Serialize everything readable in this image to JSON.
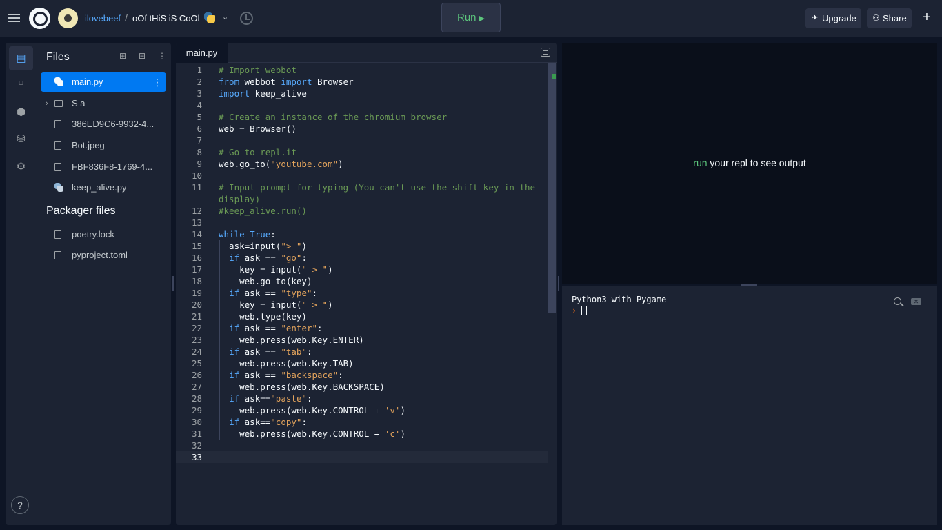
{
  "topbar": {
    "username": "ilovebeef",
    "separator": "/",
    "repl_name": "oOf tHiS iS CoOl",
    "run_label": "Run",
    "run_icon": "▶",
    "upgrade_label": "Upgrade",
    "share_label": "Share",
    "plus_label": "+"
  },
  "sidebar": {
    "files_title": "Files",
    "packager_title": "Packager files",
    "files": [
      {
        "name": "main.py",
        "icon": "python-icon",
        "selected": true
      },
      {
        "name": "S a",
        "icon": "folder-icon"
      },
      {
        "name": "386ED9C6-9932-4...",
        "icon": "file-icon"
      },
      {
        "name": "Bot.jpeg",
        "icon": "file-icon"
      },
      {
        "name": "FBF836F8-1769-4...",
        "icon": "file-icon"
      },
      {
        "name": "keep_alive.py",
        "icon": "python-icon"
      }
    ],
    "packager_files": [
      {
        "name": "poetry.lock"
      },
      {
        "name": "pyproject.toml"
      }
    ],
    "help_label": "?"
  },
  "editor": {
    "tab_label": "main.py",
    "lines": [
      {
        "n": "1",
        "code": "# Import webbot"
      },
      {
        "n": "2",
        "code": "from webbot import Browser"
      },
      {
        "n": "3",
        "code": "import keep_alive"
      },
      {
        "n": "4",
        "code": ""
      },
      {
        "n": "5",
        "code": "# Create an instance of the chromium browser"
      },
      {
        "n": "6",
        "code": "web = Browser()"
      },
      {
        "n": "7",
        "code": ""
      },
      {
        "n": "8",
        "code": "# Go to repl.it"
      },
      {
        "n": "9",
        "code": "web.go_to(\"youtube.com\")"
      },
      {
        "n": "10",
        "code": ""
      },
      {
        "n": "11",
        "code": "# Input prompt for typing (You can't use the shift key in the"
      },
      {
        "n": "",
        "code": "display)"
      },
      {
        "n": "12",
        "code": "#keep_alive.run()"
      },
      {
        "n": "13",
        "code": ""
      },
      {
        "n": "14",
        "code": "while True:"
      },
      {
        "n": "15",
        "code": "  ask=input(\"> \")"
      },
      {
        "n": "16",
        "code": "  if ask == \"go\":"
      },
      {
        "n": "17",
        "code": "    key = input(\" > \")"
      },
      {
        "n": "18",
        "code": "    web.go_to(key)"
      },
      {
        "n": "19",
        "code": "  if ask == \"type\":"
      },
      {
        "n": "20",
        "code": "    key = input(\" > \")"
      },
      {
        "n": "21",
        "code": "    web.type(key)"
      },
      {
        "n": "22",
        "code": "  if ask == \"enter\":"
      },
      {
        "n": "23",
        "code": "    web.press(web.Key.ENTER)"
      },
      {
        "n": "24",
        "code": "  if ask == \"tab\":"
      },
      {
        "n": "25",
        "code": "    web.press(web.Key.TAB)"
      },
      {
        "n": "26",
        "code": "  if ask == \"backspace\":"
      },
      {
        "n": "27",
        "code": "    web.press(web.Key.BACKSPACE)"
      },
      {
        "n": "28",
        "code": "  if ask==\"paste\":"
      },
      {
        "n": "29",
        "code": "    web.press(web.Key.CONTROL + 'v')"
      },
      {
        "n": "30",
        "code": "  if ask==\"copy\":"
      },
      {
        "n": "31",
        "code": "    web.press(web.Key.CONTROL + 'c')"
      },
      {
        "n": "32",
        "code": ""
      },
      {
        "n": "33",
        "code": ""
      }
    ],
    "current_line": "33"
  },
  "output": {
    "run_word": "run",
    "rest": " your repl to see output"
  },
  "console": {
    "title": "Python3 with Pygame",
    "prompt": "›"
  },
  "colors": {
    "background": "#0e1525",
    "panel": "#1c2333",
    "accent": "#0079f2",
    "link": "#57abff",
    "run_green": "#5cc57c",
    "comment": "#6a9955",
    "keyword": "#57abff",
    "string": "#e2a35c",
    "prompt": "#f26f1a"
  }
}
